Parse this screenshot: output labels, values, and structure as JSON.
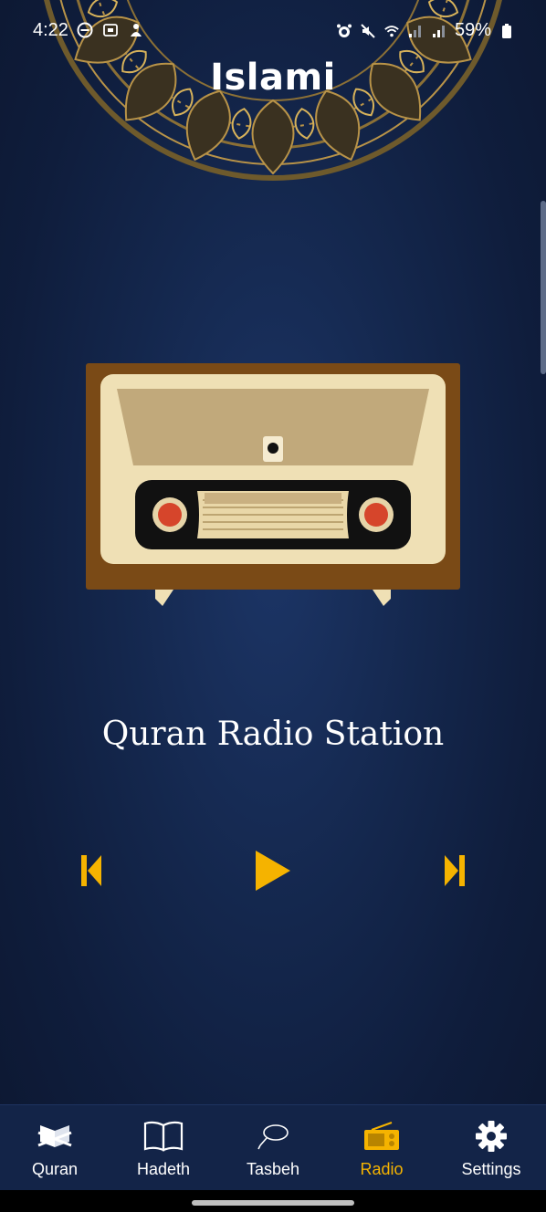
{
  "status_bar": {
    "time": "4:22",
    "battery": "59%",
    "icons": [
      "do-not-disturb-icon",
      "screen-record-icon",
      "notification-icon",
      "alarm-icon",
      "mute-icon",
      "wifi-icon",
      "signal-icon",
      "signal-icon",
      "battery-icon"
    ]
  },
  "header": {
    "title": "Islami"
  },
  "radio": {
    "station_name": "Quran Radio Station",
    "controls": [
      "skip-previous-icon",
      "play-icon",
      "skip-next-icon"
    ]
  },
  "nav": {
    "items": [
      {
        "label": "Quran",
        "icon": "quran-book-icon"
      },
      {
        "label": "Hadeth",
        "icon": "open-book-icon"
      },
      {
        "label": "Tasbeh",
        "icon": "prayer-beads-icon"
      },
      {
        "label": "Radio",
        "icon": "radio-icon"
      },
      {
        "label": "Settings",
        "icon": "gear-icon"
      }
    ],
    "active": "Radio"
  },
  "colors": {
    "accent": "#f5b300",
    "background": "#14274d",
    "nav_background": "#132448",
    "mandala_gold": "#b89348"
  }
}
